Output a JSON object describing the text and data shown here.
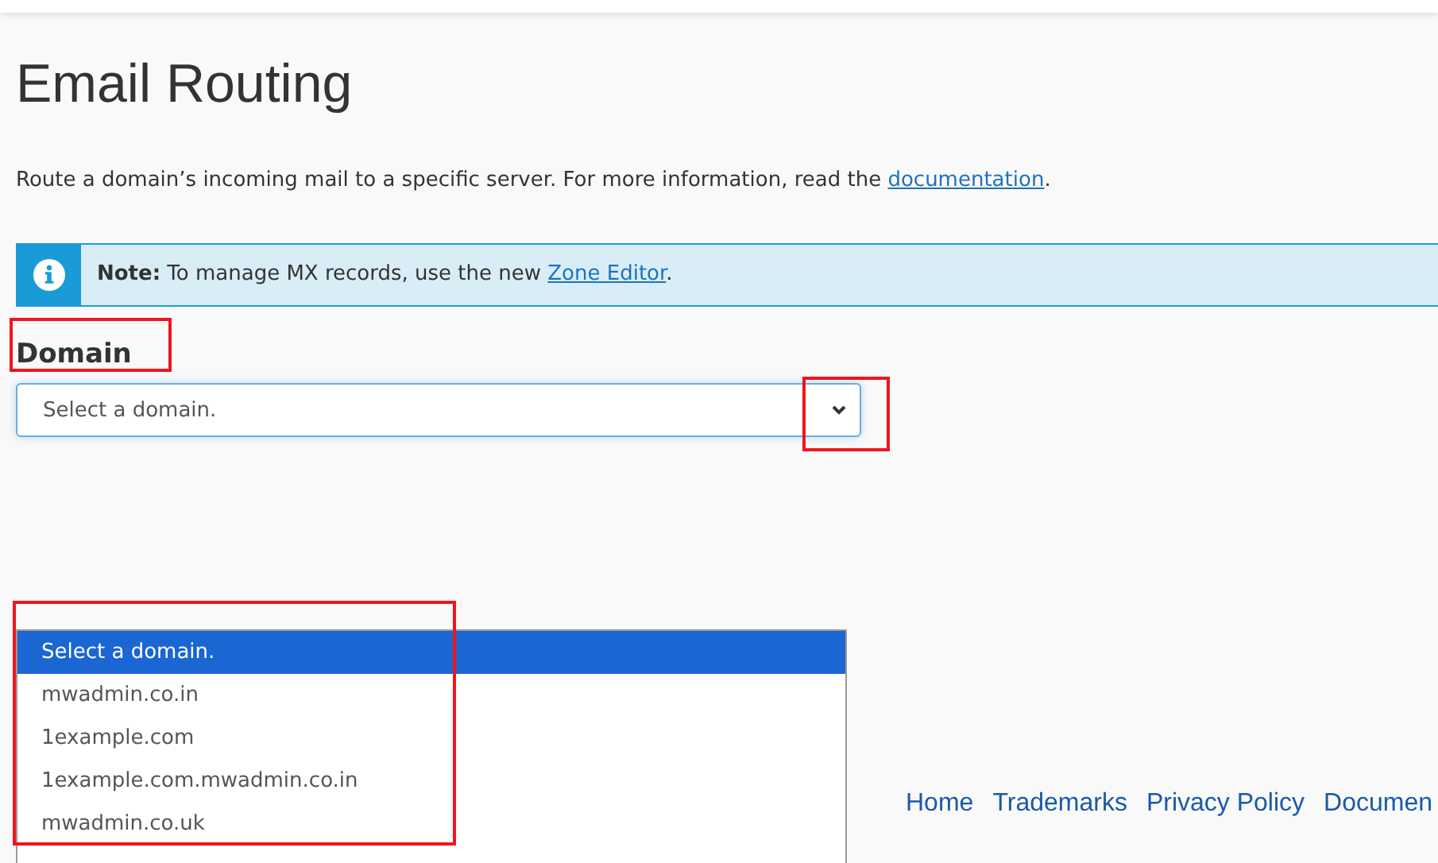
{
  "page": {
    "title": "Email Routing",
    "description": "Route a domain’s incoming mail to a specific server. For more information, read the ",
    "description_link": "documentation",
    "description_end": "."
  },
  "note": {
    "label": "Note:",
    "text": " To manage MX records, use the new ",
    "link": "Zone Editor",
    "end": "."
  },
  "domain": {
    "label": "Domain",
    "value": "Select a domain.",
    "options": [
      {
        "label": "Select a domain.",
        "selected": true
      },
      {
        "label": "mwadmin.co.in",
        "selected": false
      },
      {
        "label": "1example.com",
        "selected": false
      },
      {
        "label": "1example.com.mwadmin.co.in",
        "selected": false
      },
      {
        "label": "mwadmin.co.uk",
        "selected": false
      }
    ]
  },
  "footer": {
    "links": [
      "Home",
      "Trademarks",
      "Privacy Policy",
      "Documen"
    ]
  }
}
